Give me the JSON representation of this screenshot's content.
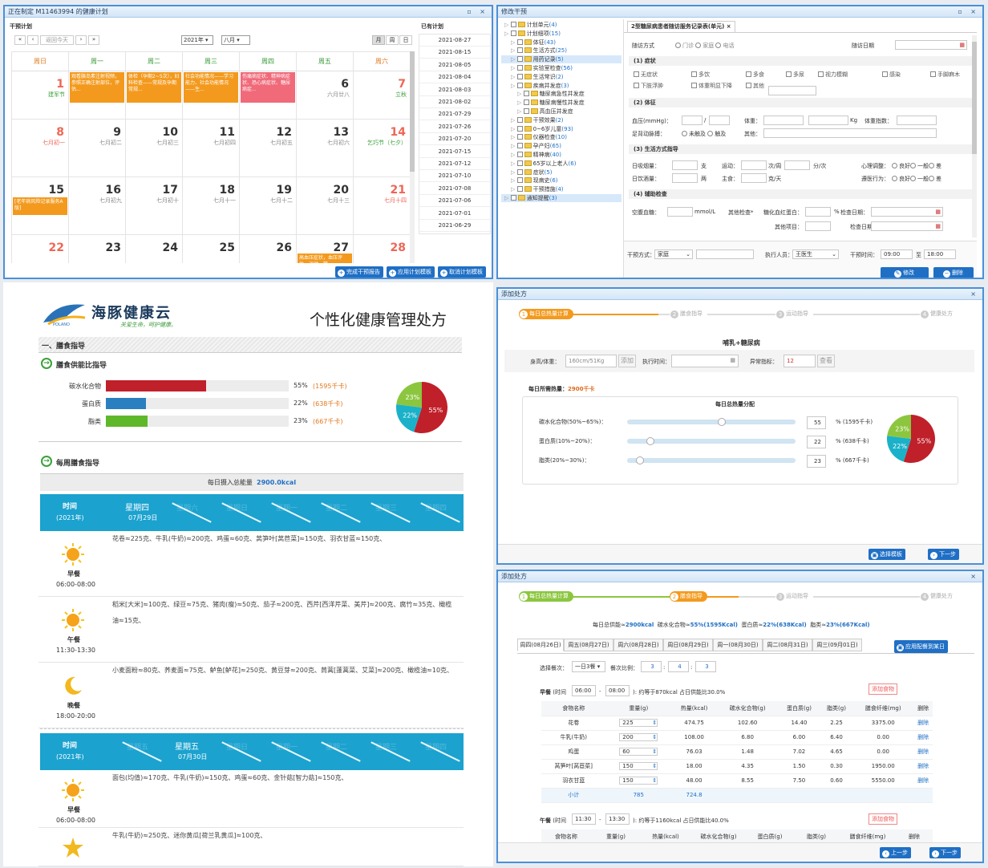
{
  "cal": {
    "title": "正在制定 M11463994 的健康计划",
    "section": "干预计划",
    "nav_today": "返回今天",
    "year": "2021年",
    "month": "八月",
    "views": [
      "月",
      "周",
      "日"
    ],
    "weekdays": [
      "周日",
      "周一",
      "周二",
      "周三",
      "周四",
      "周五",
      "周六"
    ],
    "rows": [
      [
        {
          "d": "1",
          "s": "建军节",
          "hol": true,
          "sg": true
        },
        {
          "d": "",
          "s": ""
        },
        {
          "d": "",
          "s": ""
        },
        {
          "d": "",
          "s": ""
        },
        {
          "d": "",
          "s": ""
        },
        {
          "d": "6",
          "s": "六月廿八"
        },
        {
          "d": "7",
          "s": "立秋",
          "hol": true,
          "sg": true
        }
      ],
      [
        {
          "d": "8",
          "s": "七月初一",
          "hol": true
        },
        {
          "d": "9",
          "s": "七月初二"
        },
        {
          "d": "10",
          "s": "七月初三"
        },
        {
          "d": "11",
          "s": "七月初四"
        },
        {
          "d": "12",
          "s": "七月初五"
        },
        {
          "d": "13",
          "s": "七月初六"
        },
        {
          "d": "14",
          "s": "乞巧节（七夕）",
          "hol": true,
          "sg": true
        }
      ],
      [
        {
          "d": "15",
          "s": ""
        },
        {
          "d": "16",
          "s": "七月初九"
        },
        {
          "d": "17",
          "s": "七月初十"
        },
        {
          "d": "18",
          "s": "七月十一"
        },
        {
          "d": "19",
          "s": "七月十二"
        },
        {
          "d": "20",
          "s": "七月十三"
        },
        {
          "d": "21",
          "s": "七月十四",
          "hol": true
        }
      ],
      [
        {
          "d": "22",
          "s": "",
          "hol": true
        },
        {
          "d": "23",
          "s": ""
        },
        {
          "d": "24",
          "s": ""
        },
        {
          "d": "25",
          "s": ""
        },
        {
          "d": "26",
          "s": ""
        },
        {
          "d": "27",
          "s": ""
        },
        {
          "d": "28",
          "s": "",
          "hol": true
        }
      ]
    ],
    "events": {
      "e1": "观看胰岛素注射视频，参照正确注射部位，评估...",
      "e2": "体检（孕期2~5次），妇科检查——常规及孕期常规...",
      "e3": "社会功能情况——学习能力、社会功能情况——生...",
      "e4": "伤痛病症状、精神病症状、恐心病症状、糖尿病症...",
      "e5": "[老年病风险记录服务A版]",
      "e6": "高血压症状，血压评估，运动，管..."
    },
    "planned_title": "已有计划",
    "planned": [
      "2021-08-27",
      "2021-08-15",
      "2021-08-05",
      "2021-08-04",
      "2021-08-03",
      "2021-08-02",
      "2021-07-29",
      "2021-07-26",
      "2021-07-20",
      "2021-07-15",
      "2021-07-12",
      "2021-07-10",
      "2021-07-08",
      "2021-07-06",
      "2021-07-01",
      "2021-06-29"
    ],
    "btn_done": "完成干预报告",
    "btn_apply": "应用计划模板",
    "btn_cancel": "取消计划模板"
  },
  "modify": {
    "title": "修改干预",
    "tree": [
      {
        "t": "计划单元",
        "c": "(4)",
        "l": 0
      },
      {
        "t": "计划细项",
        "c": "(15)",
        "l": 0
      },
      {
        "t": "体征",
        "c": "(43)",
        "l": 1
      },
      {
        "t": "生活方式",
        "c": "(25)",
        "l": 1
      },
      {
        "t": "用药记录",
        "c": "(5)",
        "l": 1,
        "sel": true
      },
      {
        "t": "实验室检查",
        "c": "(56)",
        "l": 1
      },
      {
        "t": "生活常识",
        "c": "(2)",
        "l": 1
      },
      {
        "t": "疾病并发症",
        "c": "(3)",
        "l": 1
      },
      {
        "t": "糖尿病急性并发症",
        "c": "",
        "l": 2
      },
      {
        "t": "糖尿病慢性并发症",
        "c": "",
        "l": 2
      },
      {
        "t": "高血压并发症",
        "c": "",
        "l": 2
      },
      {
        "t": "干预效果",
        "c": "(2)",
        "l": 1
      },
      {
        "t": "0~6岁儿童",
        "c": "(93)",
        "l": 1
      },
      {
        "t": "仪器检查",
        "c": "(10)",
        "l": 1
      },
      {
        "t": "孕产妇",
        "c": "(65)",
        "l": 1
      },
      {
        "t": "精神病",
        "c": "(40)",
        "l": 1
      },
      {
        "t": "65岁以上老人",
        "c": "(6)",
        "l": 1
      },
      {
        "t": "症状",
        "c": "(5)",
        "l": 1
      },
      {
        "t": "现病史",
        "c": "(6)",
        "l": 1
      },
      {
        "t": "干预措施",
        "c": "(4)",
        "l": 1
      },
      {
        "t": "通知提醒",
        "c": "(3)",
        "l": 0,
        "sel": true
      }
    ],
    "tab": "2型糖尿病患者随访服务记录表(单元)",
    "visit_mode": "随访方式",
    "visit_opts": [
      "门诊",
      "家庭",
      "电话"
    ],
    "visit_date": "随访日期",
    "s1": "(1) 症状",
    "sym": [
      "无症状",
      "多饮",
      "多食",
      "多尿",
      "视力模糊",
      "感染",
      "手脚麻木",
      "下肢浮肿",
      "体重明显下降",
      "其他"
    ],
    "s2": "(2) 体征",
    "bp": "血压(mmHg)：",
    "wt": "体重：",
    "kg": "Kg",
    "bmi": "体重指数：",
    "pulse": "足背动脉搏：",
    "pulse_opts": [
      "未触及",
      "触及"
    ],
    "other": "其他：",
    "s3": "(3) 生活方式指导",
    "smoke": "日吸烟量：",
    "smoke_u": "支",
    "sport": "运动：",
    "sport_u1": "次/周",
    "sport_u2": "分/次",
    "psy": "心理调整：",
    "psy_opts": [
      "良好",
      "一般",
      "差"
    ],
    "drink": "日饮酒量：",
    "drink_u": "两",
    "food": "主食：",
    "food_u": "克/天",
    "comply": "遵医行为：",
    "s4": "(4) 辅助检查",
    "fbg": "空腹血糖：",
    "fbg_u": "mmol/L",
    "other_chk": "其他检查*",
    "hba1c": "糖化血红蛋白：",
    "pct": "%",
    "chk_date": "检查日期：",
    "other_item": "其他项目：",
    "mode_lbl": "干预方式：",
    "mode_val": "家庭",
    "exec_lbl": "执行人员：",
    "exec_val": "王医生",
    "time_lbl": "干预时间：",
    "t1": "09:00",
    "to": "至",
    "t2": "18:00",
    "btn_edit": "修改",
    "btn_del": "删除"
  },
  "rx": {
    "brand": "海豚健康云",
    "slogan": "关爱生命，呵护健康。",
    "logo_sub": "POLANO",
    "title": "个性化健康管理处方",
    "sec1": "一、膳食指导",
    "sub1": "膳食供能比指导",
    "bars": [
      {
        "name": "碳水化合物",
        "pct": "55%",
        "kcal": "(1595千卡)",
        "v": 55,
        "color": "#c0202a"
      },
      {
        "name": "蛋白质",
        "pct": "22%",
        "kcal": "(638千卡)",
        "v": 22,
        "color": "#2a7fc0"
      },
      {
        "name": "脂类",
        "pct": "23%",
        "kcal": "(667千卡)",
        "v": 23,
        "color": "#5fb82a"
      }
    ],
    "sub2": "每周膳食指导",
    "daily_lbl": "每日摄入总能量",
    "daily_val": "2900.0kcal",
    "time_lbl": "时间",
    "year_lbl": "(2021年)",
    "day1": "星期四",
    "day1d": "07月29日",
    "day2": "星期五",
    "day2d": "07月30日",
    "ghost": [
      "星期五",
      "星期六",
      "星期日",
      "星期一",
      "星期二",
      "星期三",
      "星期四"
    ],
    "meals": [
      {
        "name": "早餐",
        "time": "06:00-08:00",
        "icon": "sun",
        "text": "花卷≈225克、牛乳(牛奶)≈200克、鸡蛋≈60克、莴笋叶[莴苣菜]≈150克、羽衣甘蓝≈150克、"
      },
      {
        "name": "午餐",
        "time": "11:30-13:30",
        "icon": "sun",
        "text": "稻米[大米]≈100克、绿豆≈75克、猪肉(瘦)≈50克、茄子≈200克、西芹[西洋芹菜、美芹]≈200克、腐竹≈35克、橄榄油≈15克、"
      },
      {
        "name": "晚餐",
        "time": "18:00-20:00",
        "icon": "moon",
        "text": "小麦面粉≈80克、荞麦面≈75克、鲈鱼[鲈花]≈250克、黄豆芽≈200克、茼蒿[蓬蒿菜、艾菜]≈200克、橄榄油≈10克、"
      },
      {
        "name": "早餐",
        "time": "06:00-08:00",
        "icon": "sun",
        "text": "面包(均值)≈170克、牛乳(牛奶)≈150克、鸡蛋≈60克、金针菇[智力菇]≈150克、"
      },
      {
        "name": "",
        "time": "",
        "icon": "star",
        "text": "牛乳(牛奶)≈250克、迷你黄瓜[荷兰乳黄瓜]≈100克、"
      }
    ]
  },
  "add1": {
    "title": "添加处方",
    "steps": [
      "每日总热量计算",
      "膳食指导",
      "运动指导",
      "健康处方"
    ],
    "disease": "哺乳+糖尿病",
    "hw_lbl": "身高/体重：",
    "hw_val": "160cm/51Kg",
    "add": "添加",
    "exec_time": "执行时间：",
    "abn": "异常指标：",
    "abn_val": "12",
    "view": "查看",
    "need_lbl": "每日所需热量：",
    "need_val": "2900千卡",
    "dist_title": "每日总热量分配",
    "sliders": [
      {
        "name": "碳水化合物(50%~65%)：",
        "val": "55",
        "kcal": "% (1595千卡)",
        "v": 55
      },
      {
        "name": "蛋白质(10%~20%)：",
        "val": "22",
        "kcal": "% (638千卡)",
        "v": 22
      },
      {
        "name": "脂类(20%~30%)：",
        "val": "23",
        "kcal": "% (667千卡)",
        "v": 23
      }
    ],
    "btn_tpl": "选择模板",
    "btn_next": "下一步"
  },
  "add2": {
    "title": "添加处方",
    "steps": [
      "每日总热量计算",
      "膳食指导",
      "运动指导",
      "健康处方"
    ],
    "summary_a": "每日总供能≈",
    "summary_av": "2900kcal",
    "summary_b": "碳水化合物≈",
    "summary_bv": "55%(1595Kcal)",
    "summary_c": "蛋白质≈",
    "summary_cv": "22%(638Kcal)",
    "summary_d": "脂类≈",
    "summary_dv": "23%(667Kcal)",
    "tabs": [
      "周四(08月26日)",
      "周五(08月27日)",
      "周六(08月28日)",
      "周日(08月29日)",
      "周一(08月30日)",
      "周二(08月31日)",
      "周三(09月01日)"
    ],
    "apply_all": "应用配餐到某日",
    "meal_cnt_lbl": "选择餐次：",
    "meal_cnt": "一日3餐",
    "ratio_lbl": "餐次比例：",
    "ratio": [
      "3",
      "4",
      "3"
    ],
    "bf_lbl": "早餐",
    "bf_time_lbl": "(时间",
    "bf_t1": "06:00",
    "bf_t2": "08:00",
    "bf_note": "): 约等于870kcal  占日供能比30.0%",
    "add_food": "添加食物",
    "cols": [
      "食物名称",
      "重量(g)",
      "热量(kcal)",
      "碳水化合物(g)",
      "蛋白质(g)",
      "脂类(g)",
      "膳食纤维(mg)",
      "删除"
    ],
    "rows": [
      [
        "花卷",
        "225",
        "474.75",
        "102.60",
        "14.40",
        "2.25",
        "3375.00",
        "删除"
      ],
      [
        "牛乳(牛奶)",
        "200",
        "108.00",
        "6.80",
        "6.00",
        "6.40",
        "0.00",
        "删除"
      ],
      [
        "鸡蛋",
        "60",
        "76.03",
        "1.48",
        "7.02",
        "4.65",
        "0.00",
        "删除"
      ],
      [
        "莴笋叶[莴苣菜]",
        "150",
        "18.00",
        "4.35",
        "1.50",
        "0.30",
        "1950.00",
        "删除"
      ],
      [
        "羽衣甘蓝",
        "150",
        "48.00",
        "8.55",
        "7.50",
        "0.60",
        "5550.00",
        "删除"
      ]
    ],
    "subtotal": [
      "小计",
      "785",
      "724.8"
    ],
    "lu_lbl": "午餐",
    "lu_time_lbl": "(时间",
    "lu_t1": "11:30",
    "lu_t2": "13:30",
    "lu_note": "): 约等于1160kcal  占日供能比40.0%",
    "btn_prev": "上一步",
    "btn_next": "下一步"
  },
  "colors": {
    "accent": "#1f6fc5",
    "orange": "#f39a1e",
    "green": "#8cc63f",
    "red": "#c0202a",
    "teal": "#1ab1c9"
  }
}
